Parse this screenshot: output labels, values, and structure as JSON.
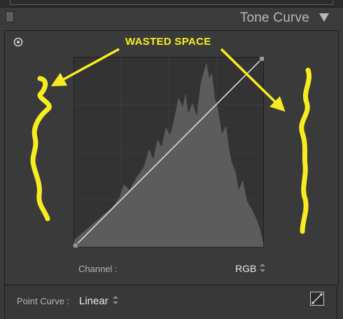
{
  "panel": {
    "title": "Tone Curve",
    "icons": {
      "collapse": "triangle-down-icon",
      "switch": "panel-switch-icon",
      "target": "targeted-adjustment-icon",
      "edit_curve": "edit-point-curve-icon"
    }
  },
  "channel": {
    "label": "Channel :",
    "value": "RGB"
  },
  "point_curve": {
    "label": "Point Curve :",
    "value": "Linear"
  },
  "annotation": {
    "text": "WASTED SPACE",
    "color": "#f7ec22"
  },
  "colors": {
    "panel_bg": "#3a3a3a",
    "graph_bg": "#333333",
    "histogram": "#5c5c5c",
    "curve_line": "#e6e6e6",
    "annotation": "#f7ec22"
  }
}
